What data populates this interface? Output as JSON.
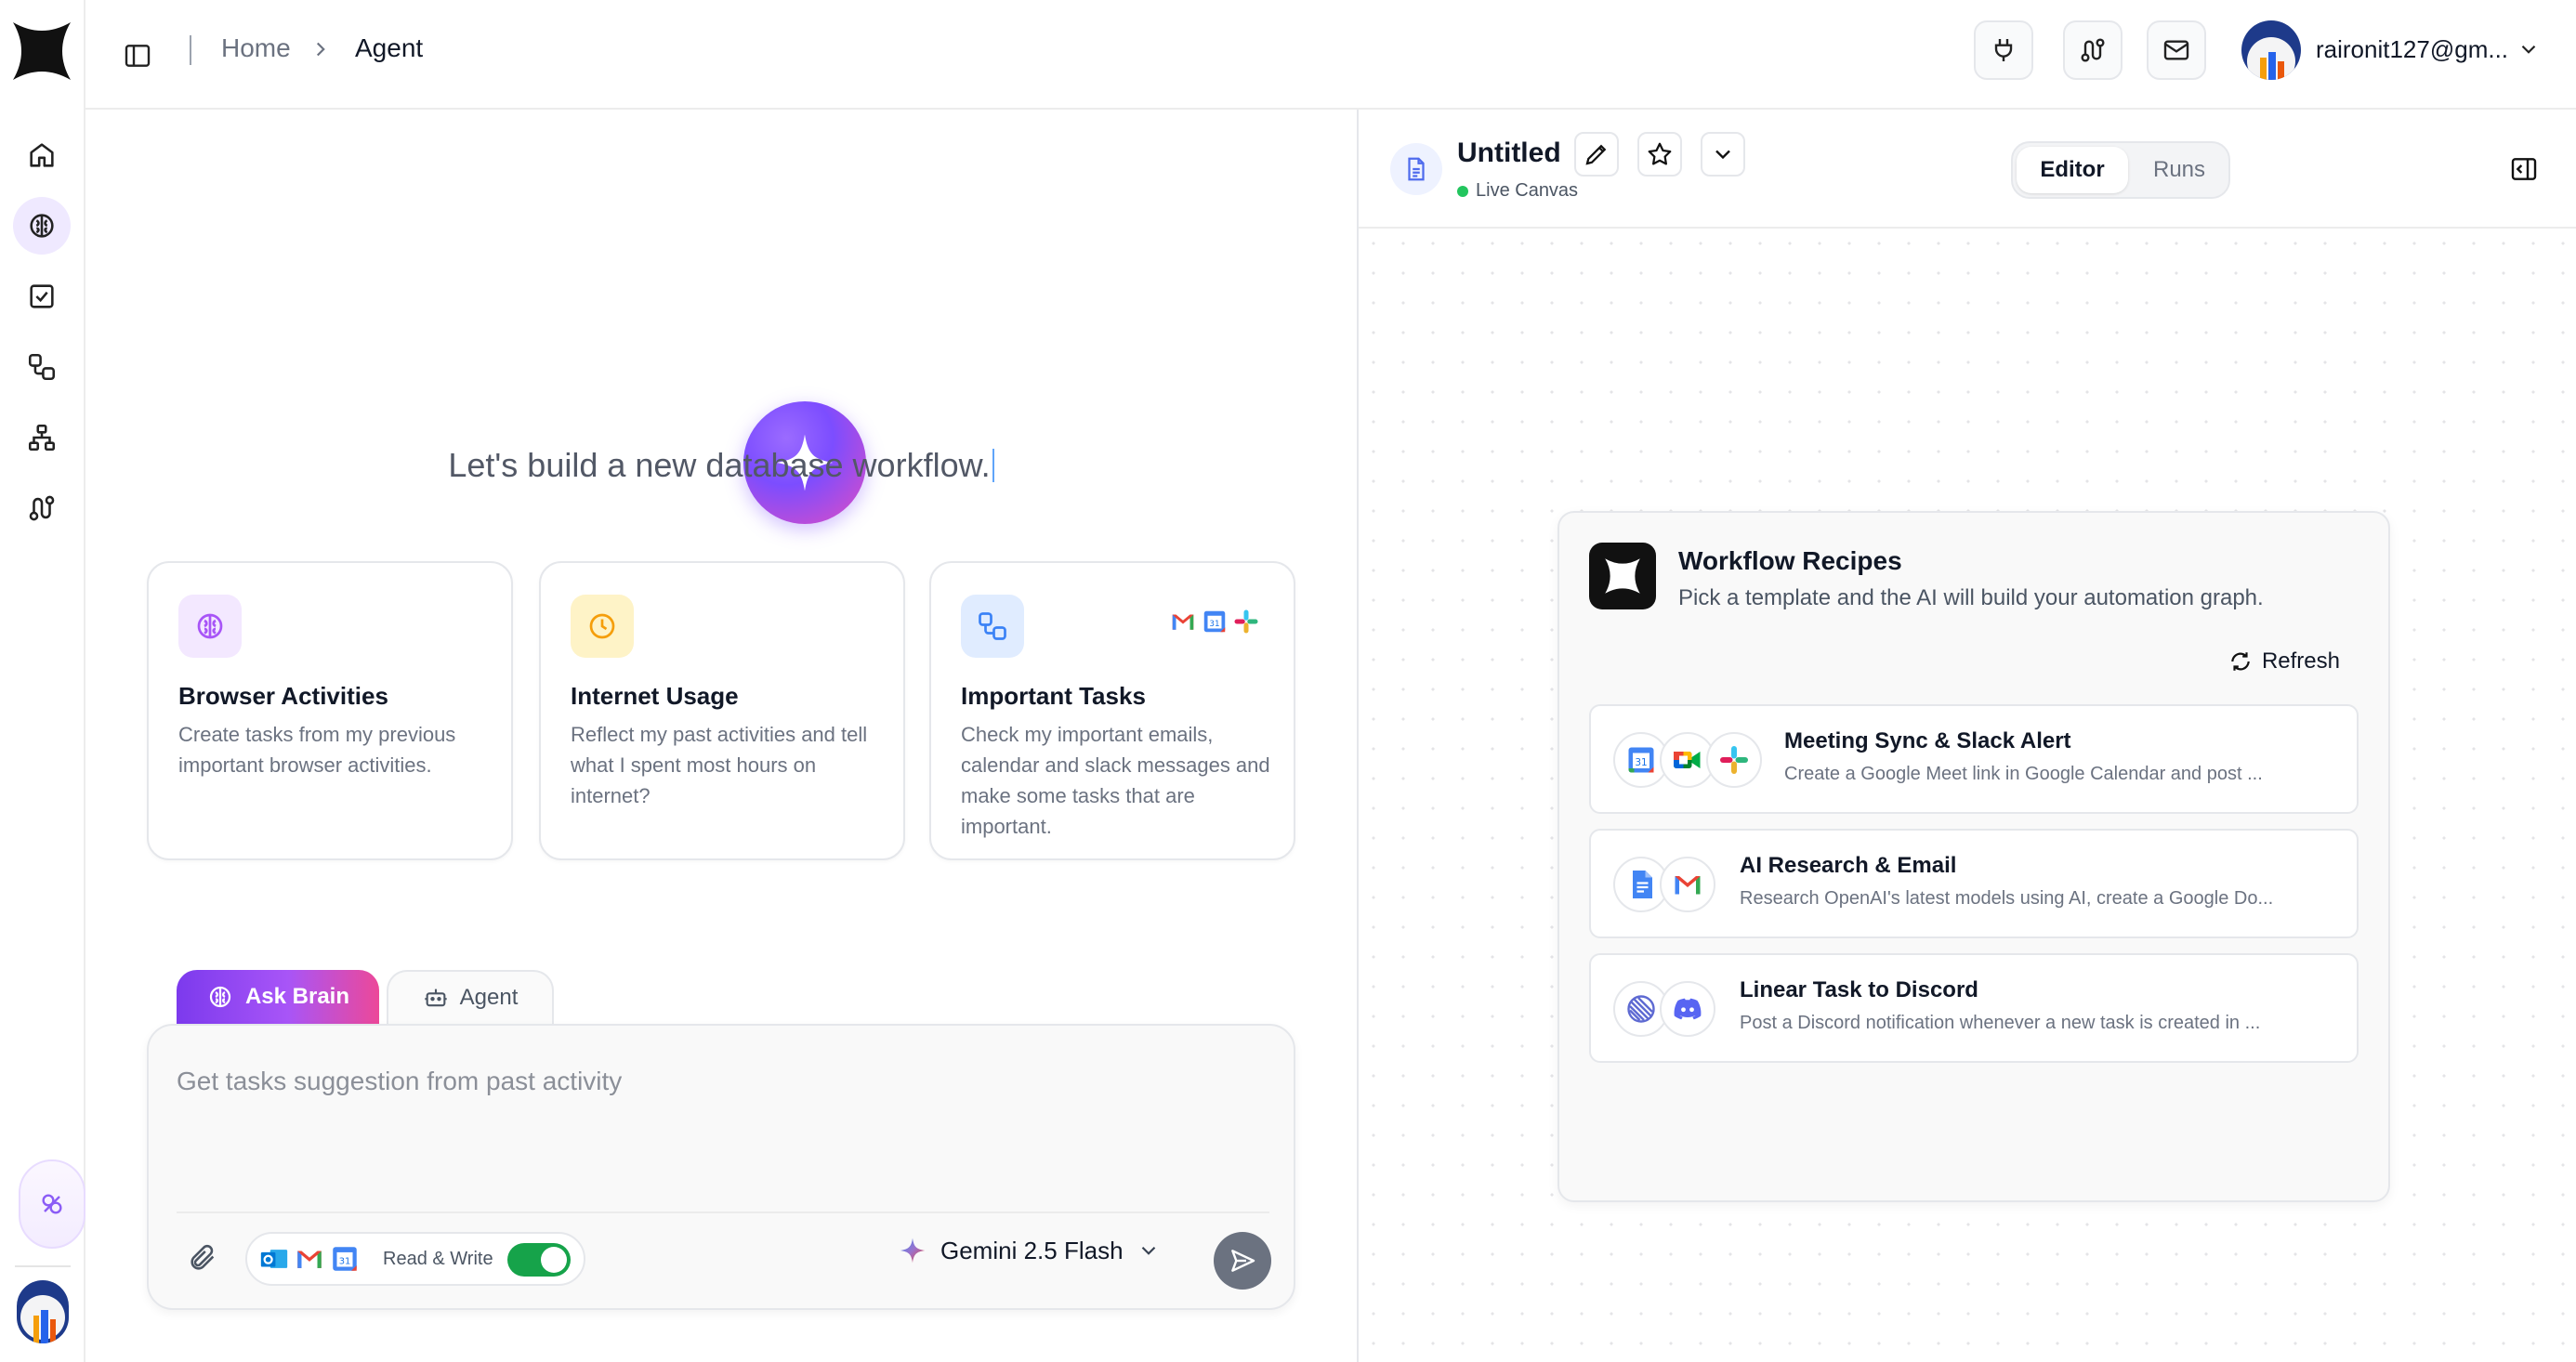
{
  "header": {
    "breadcrumb": {
      "home": "Home",
      "current": "Agent"
    },
    "user_email": "raironit127@gm..."
  },
  "hero": {
    "text": "Let's build a new database workflow."
  },
  "cards": [
    {
      "title": "Browser Activities",
      "description": "Create tasks from my previous important browser activities.",
      "icon": "brain-icon",
      "accent": "#a855f7"
    },
    {
      "title": "Internet Usage",
      "description": "Reflect my past activities and tell what I spent most hours on internet?",
      "icon": "clock-icon",
      "accent": "#f59e0b"
    },
    {
      "title": "Important Tasks",
      "description": "Check my important emails, calendar and slack messages and make some tasks that are important.",
      "icon": "workflow-icon",
      "accent": "#3b82f6"
    }
  ],
  "composer": {
    "tabs": {
      "ask_brain": "Ask Brain",
      "agent": "Agent"
    },
    "placeholder": "Get tasks suggestion from past activity",
    "permission_label": "Read & Write",
    "permission_enabled": true,
    "model": "Gemini 2.5 Flash"
  },
  "canvas": {
    "doc_title": "Untitled",
    "status": "Live Canvas",
    "tabs": {
      "editor": "Editor",
      "runs": "Runs"
    },
    "active_tab": "Editor",
    "recipes": {
      "title": "Workflow Recipes",
      "subtitle": "Pick a template and the AI will build your automation graph.",
      "refresh": "Refresh",
      "items": [
        {
          "title": "Meeting Sync & Slack Alert",
          "description": "Create a Google Meet link in Google Calendar and post ...",
          "apps": [
            "google-calendar-icon",
            "google-meet-icon",
            "slack-icon"
          ]
        },
        {
          "title": "AI Research & Email",
          "description": "Research OpenAI's latest models using AI, create a Google Do...",
          "apps": [
            "google-docs-icon",
            "gmail-icon"
          ]
        },
        {
          "title": "Linear Task to Discord",
          "description": "Post a Discord notification whenever a new task is created in ...",
          "apps": [
            "linear-icon",
            "discord-icon"
          ]
        }
      ]
    }
  },
  "colors": {
    "accent_purple": "#7c3aed",
    "accent_pink": "#ec4899",
    "toggle_green": "#16a34a",
    "live_green": "#22c55e"
  }
}
